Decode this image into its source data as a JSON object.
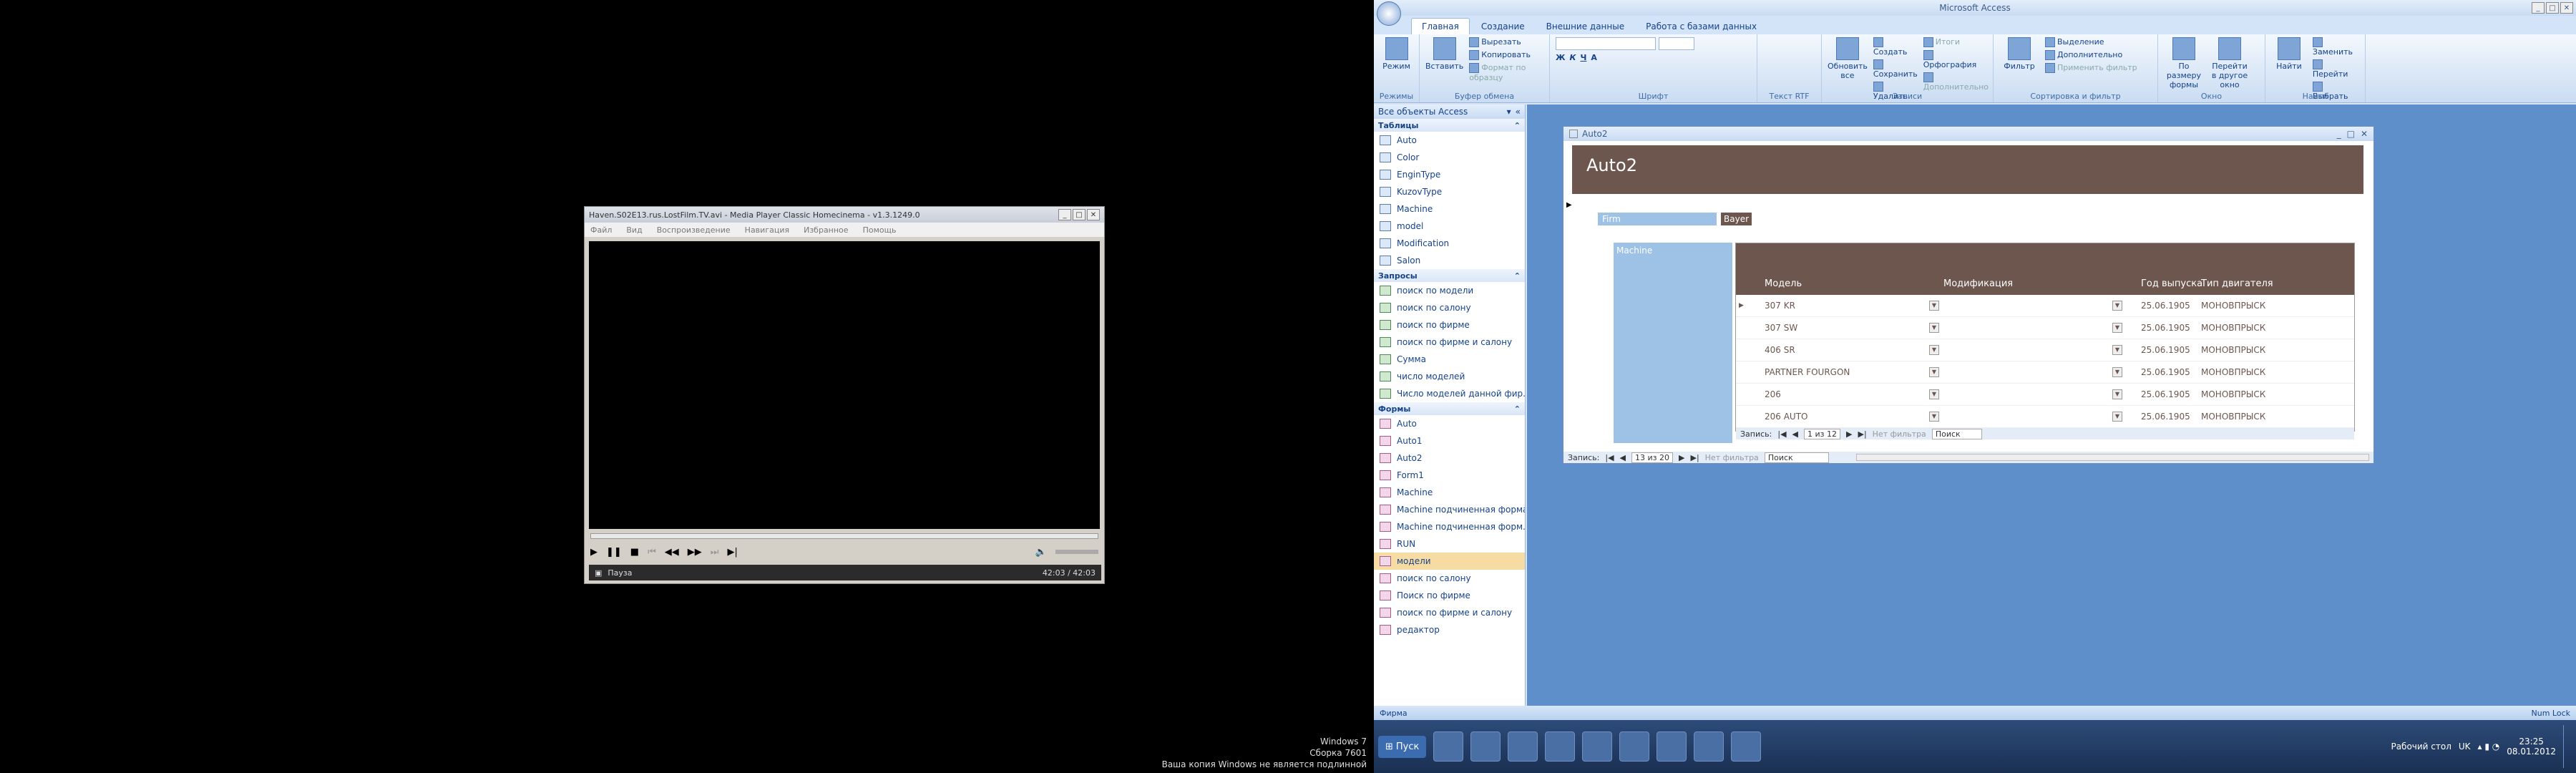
{
  "mpc": {
    "title": "Haven.S02E13.rus.LostFilm.TV.avi - Media Player Classic Homecinema - v1.3.1249.0",
    "menu": [
      "Файл",
      "Вид",
      "Воспроизведение",
      "Навигация",
      "Избранное",
      "Помощь"
    ],
    "status": "Пауза",
    "time": "42:03 / 42:03"
  },
  "access": {
    "title": "Microsoft Access",
    "tabs": [
      "Главная",
      "Создание",
      "Внешние данные",
      "Работа с базами данных"
    ],
    "ribbon": {
      "rejim": "Режим",
      "vstavit": "Вставить",
      "cut": "Вырезать",
      "copy": "Копировать",
      "formatpaint": "Формат по образцу",
      "refresh": "Обновить все",
      "create": "Создать",
      "save": "Сохранить",
      "delete": "Удалить",
      "totals": "Итоги",
      "spelling": "Орфография",
      "more": "Дополнительно",
      "filter": "Фильтр",
      "selection": "Выделение",
      "advanced": "Дополнительно",
      "applyfilter": "Применить фильтр",
      "fitform": "По размеру формы",
      "switch": "Перейти в другое окно",
      "find": "Найти",
      "replace": "Заменить",
      "goto": "Перейти",
      "select": "Выбрать",
      "groups": [
        "Режимы",
        "Буфер обмена",
        "Шрифт",
        "Текст RTF",
        "Записи",
        "Сортировка и фильтр",
        "Окно",
        "Найти"
      ]
    },
    "nav": {
      "header": "Все объекты Access",
      "tables_label": "Таблицы",
      "tables": [
        "Auto",
        "Color",
        "EnginType",
        "KuzovType",
        "Machine",
        "model",
        "Modification",
        "Salon"
      ],
      "queries_label": "Запросы",
      "queries": [
        "поиск по модели",
        "поиск по салону",
        "поиск по фирме",
        "поиск по фирме и салону",
        "Сумма",
        "число моделей",
        "Число моделей данной фир..."
      ],
      "forms_label": "Формы",
      "forms": [
        "Auto",
        "Auto1",
        "Auto2",
        "Form1",
        "Machine",
        "Machine подчиненная форма",
        "Machine подчиненная форм...",
        "RUN",
        "модели",
        "поиск по салону",
        "Поиск по фирме",
        "поиск по фирме и салону",
        "редактор"
      ]
    },
    "form": {
      "window_title": "Auto2",
      "header": "Auto2",
      "field_label": "Firm",
      "field_value": "Bayer",
      "sub_label": "Machine",
      "columns": [
        "Модель",
        "Модификация",
        "Год выпуска",
        "Тип двигателя"
      ],
      "rows": [
        [
          "307 KR",
          "",
          "25.06.1905",
          "МОНОВПРЫСК"
        ],
        [
          "307 SW",
          "",
          "25.06.1905",
          "МОНОВПРЫСК"
        ],
        [
          "406 SR",
          "",
          "25.06.1905",
          "МОНОВПРЫСК"
        ],
        [
          "PARTNER FOURGON",
          "",
          "25.06.1905",
          "МОНОВПРЫСК"
        ],
        [
          "206",
          "",
          "25.06.1905",
          "МОНОВПРЫСК"
        ],
        [
          "206 AUTO",
          "",
          "25.06.1905",
          "МОНОВПРЫСК"
        ]
      ],
      "sub_nav": {
        "label": "Запись:",
        "pos": "1 из 12",
        "nofilter": "Нет фильтра",
        "search": "Поиск"
      },
      "main_nav": {
        "label": "Запись:",
        "pos": "13 из 20",
        "nofilter": "Нет фильтра",
        "search": "Поиск"
      }
    },
    "status_left": "Фирма",
    "status_right": "Num Lock"
  },
  "taskbar": {
    "start": "Пуск",
    "desktop": "Рабочий стол",
    "lang": "UK",
    "time": "23:25",
    "date": "08.01.2012"
  },
  "watermark": [
    "Windows 7",
    "Сборка 7601",
    "Ваша копия Windows не является подлинной"
  ]
}
